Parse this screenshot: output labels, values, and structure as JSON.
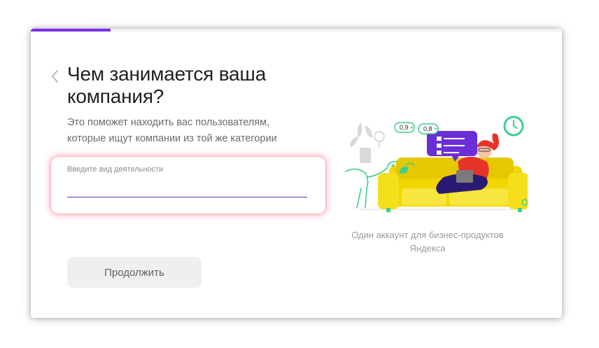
{
  "progress": {
    "value": 0.15,
    "color": "#7b2ee6"
  },
  "header": {
    "title": "Чем занимается ваша компания?",
    "subtitle": "Это поможет находить вас пользователям, которые ищут компании из той же категории"
  },
  "form": {
    "activity_label": "Введите вид деятельности",
    "activity_value": "",
    "continue_label": "Продолжить"
  },
  "illustration": {
    "badge_1": "0,9",
    "badge_2": "0,8"
  },
  "promo": {
    "caption": "Один аккаунт для бизнес-продуктов Яндекса"
  },
  "icons": {
    "back": "chevron-left-icon",
    "clock": "clock-icon",
    "checklist": "checklist-icon"
  }
}
